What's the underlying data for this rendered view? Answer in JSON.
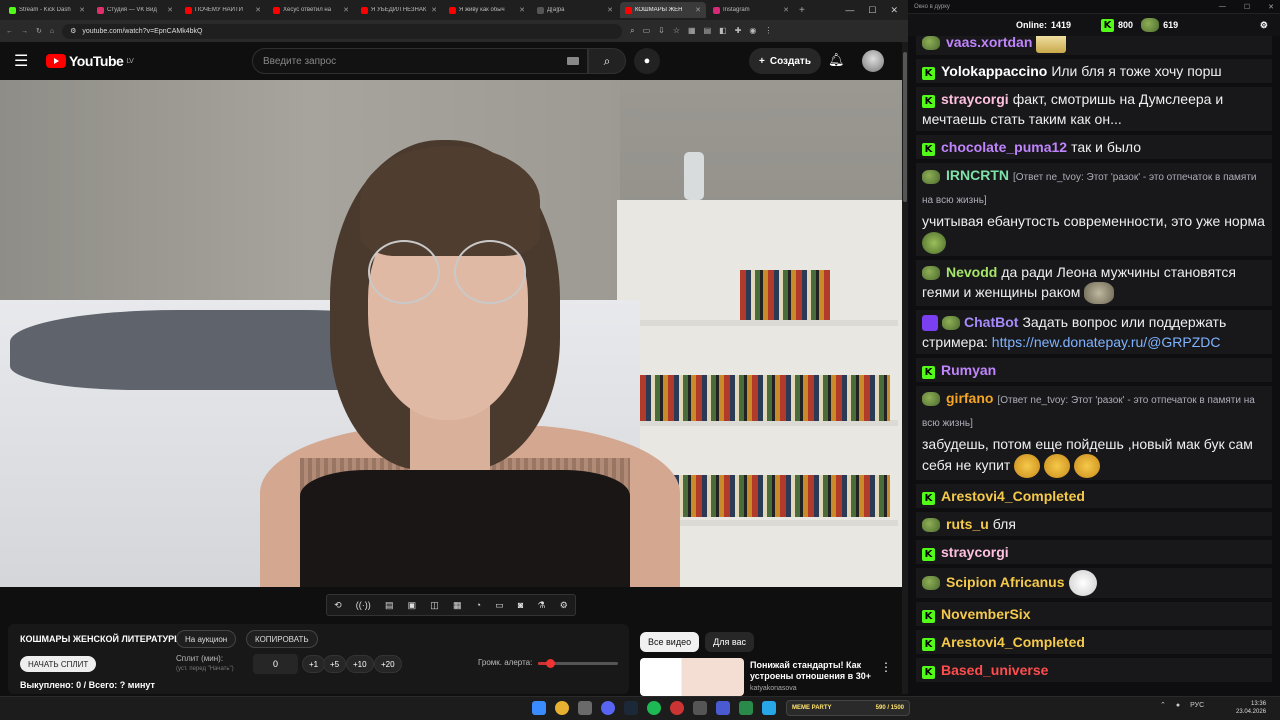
{
  "browser": {
    "tabs": [
      {
        "label": "Stream - Kick Dash",
        "color": "#53fc18"
      },
      {
        "label": "Студия — VK Вид",
        "color": "#e0306a"
      },
      {
        "label": "ПОЧЕМУ НАЙТИ",
        "color": "#ff0000"
      },
      {
        "label": "Хесус ответил на",
        "color": "#ff0000"
      },
      {
        "label": "Я УБЕДИЛ НЕЗНАК",
        "color": "#ff0000"
      },
      {
        "label": "Я живу как обыч",
        "color": "#ff0000"
      },
      {
        "label": "Д[а]ра",
        "color": "#555555"
      },
      {
        "label": "КОШМАРЫ ЖЕН",
        "color": "#ff0000",
        "active": true
      },
      {
        "label": "Instagram",
        "color": "#d62976"
      }
    ],
    "new_tab": "+",
    "url": "youtube.com/watch?v=EpnCAMk4bkQ"
  },
  "youtube": {
    "logo_text": "YouTube",
    "logo_region": "LV",
    "search_placeholder": "Введите запрос",
    "create_label": "Создать"
  },
  "panel": {
    "title": "КОШМАРЫ ЖЕНСКОЙ ЛИТЕРАТУРЫ",
    "auction_label": "На аукцион",
    "copy_label": "КОПИРОВАТЬ",
    "start_split_label": "НАЧАТЬ СПЛИТ",
    "split_label": "Сплит (мин):",
    "split_hint": "(уст. перед \"Начать\")",
    "split_value": "0",
    "steps": [
      "+1",
      "+5",
      "+10",
      "+20"
    ],
    "volume_label": "Громк. алерта:",
    "volume_level": 0.15,
    "bought_text": "Выкуплено: 0 / Всего: ? минут"
  },
  "recommendations": {
    "chips": [
      "Все видео",
      "Для вас"
    ],
    "video": {
      "title": "Понижай стандарты! Как устроены отношения в 30+",
      "channel": "katyakonasova"
    }
  },
  "chat": {
    "window_title": "Окно в дурку",
    "online_label": "Online:",
    "online_count": "1419",
    "stat_a": "800",
    "stat_b": "619",
    "messages": [
      {
        "user": "vaas.xortdan",
        "color": "#c084fc",
        "badge": "pepe",
        "reply": "",
        "text": "",
        "emote": "gold"
      },
      {
        "user": "Yolokappaccino",
        "color": "#ffffff",
        "badge": "kick",
        "reply": "",
        "text": "Или бля я тоже хочу порш",
        "emote": ""
      },
      {
        "user": "straycorgi",
        "color": "#ffc0e0",
        "badge": "kick",
        "reply": "",
        "text": "факт, смотришь на Думслеера и мечтаешь стать таким как он...",
        "emote": ""
      },
      {
        "user": "chocolate_puma12",
        "color": "#c084fc",
        "badge": "kick",
        "reply": "",
        "text": "так и было",
        "emote": "face"
      },
      {
        "user": "IRNCRTN",
        "color": "#7fe0a8",
        "badge": "pepe",
        "reply": "[Ответ ne_tvoy: Этот 'разок' - это отпечаток в памяти на всю жизнь]",
        "text": "учитывая ебанутость современности, это уже норма",
        "emote": "pepe2"
      },
      {
        "user": "Nevodd",
        "color": "#a7e46a",
        "badge": "pepe",
        "reply": "",
        "text": "да ради Леона мужчины становятся геями и женщины раком",
        "emote": "dino"
      },
      {
        "user": "ChatBot",
        "color": "#a78bfa",
        "badge": "bot",
        "reply": "",
        "text": "Задать вопрос или поддержать стримера:",
        "link": "https://new.donatepay.ru/@GRPZDC",
        "emote": ""
      },
      {
        "user": "Rumyan",
        "color": "#c084fc",
        "badge": "kick",
        "reply": "",
        "text": "",
        "emote": "face"
      },
      {
        "user": "girfano",
        "color": "#f5a524",
        "badge": "pepe",
        "reply": "[Ответ ne_tvoy: Этот 'разок' - это отпечаток в памяти на всю жизнь]",
        "text": "забудешь, потом еще пойдешь ,новый мак бук сам себя не купит",
        "emote": "laugh3"
      },
      {
        "user": "Arestovi4_Completed",
        "color": "#f5c94a",
        "badge": "kick",
        "reply": "",
        "text": "",
        "emote": "face"
      },
      {
        "user": "ruts_u",
        "color": "#f5c94a",
        "badge": "pepe",
        "reply": "",
        "text": "бля",
        "emote": ""
      },
      {
        "user": "straycorgi",
        "color": "#ffc0e0",
        "badge": "kick",
        "reply": "",
        "text": "",
        "emote": "face"
      },
      {
        "user": "Scipion Africanus",
        "color": "#f5c94a",
        "badge": "pepe",
        "reply": "",
        "text": "",
        "emote": "white"
      },
      {
        "user": "NovemberSix",
        "color": "#f5c94a",
        "badge": "kick",
        "reply": "",
        "text": "",
        "emote": "face"
      },
      {
        "user": "Arestovi4_Completed",
        "color": "#f5c94a",
        "badge": "kick",
        "reply": "",
        "text": "",
        "emote": "face"
      },
      {
        "user": "Based_universe",
        "color": "#ff4d4d",
        "badge": "kick",
        "reply": "",
        "text": "",
        "emote": "face"
      }
    ]
  },
  "taskbar": {
    "meme_label": "MEME PARTY",
    "meme_progress": "590 / 1500",
    "lang": "РУС",
    "time": "13:36",
    "date": "23.04.2026"
  }
}
